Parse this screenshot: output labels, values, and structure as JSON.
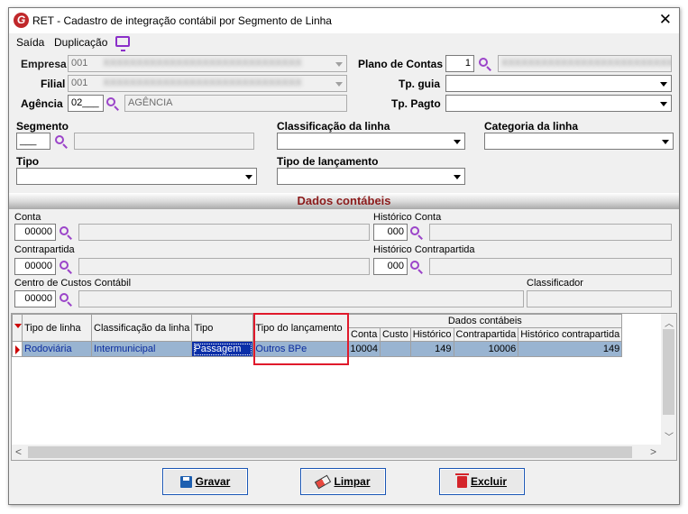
{
  "window": {
    "title": "RET - Cadastro de integração contábil por Segmento de Linha",
    "app_icon_letter": "G"
  },
  "menu": {
    "saida": "Saída",
    "duplicacao": "Duplicação"
  },
  "form": {
    "empresa": {
      "label": "Empresa",
      "code": "001",
      "desc": "XXXXXXXXXXXXXXXXXXXXXXXXXXXXXX"
    },
    "filial": {
      "label": "Filial",
      "code": "001",
      "desc": "XXXXXXXXXXXXXXXXXXXXXXXXXXXXXX"
    },
    "agencia": {
      "label": "Agência",
      "code": "02___",
      "desc": "AGÊNCIA"
    },
    "plano_contas": {
      "label": "Plano de Contas",
      "value": "1",
      "desc": "XXXXXXXXXXXXXXXXXXXXXXXXXXXX"
    },
    "tp_guia": {
      "label": "Tp. guia",
      "value": ""
    },
    "tp_pagto": {
      "label": "Tp. Pagto",
      "value": ""
    },
    "segmento": {
      "label": "Segmento",
      "value": "___",
      "desc": ""
    },
    "classificacao_linha": {
      "label": "Classificação da linha",
      "value": ""
    },
    "categoria_linha": {
      "label": "Categoria da linha",
      "value": ""
    },
    "tipo": {
      "label": "Tipo",
      "value": ""
    },
    "tipo_lancamento": {
      "label": "Tipo de lançamento",
      "value": ""
    }
  },
  "dados_contabeis": {
    "section_title": "Dados contábeis",
    "conta": {
      "label": "Conta",
      "value": "00000",
      "desc": ""
    },
    "historico_conta": {
      "label": "Histórico Conta",
      "value": "000",
      "desc": ""
    },
    "contrapartida": {
      "label": "Contrapartida",
      "value": "00000",
      "desc": ""
    },
    "historico_contrapartida": {
      "label": "Histórico Contrapartida",
      "value": "000",
      "desc": ""
    },
    "centro_custos": {
      "label": "Centro de Custos Contábil",
      "value": "00000",
      "desc": ""
    },
    "classificador": {
      "label": "Classificador",
      "value": ""
    }
  },
  "grid": {
    "group_header": "Dados contábeis",
    "columns": [
      "Tipo de linha",
      "Classificação da linha",
      "Tipo",
      "Tipo do lançamento",
      "Conta",
      "Custo",
      "Histórico",
      "Contrapartida",
      "Histórico contrapartida"
    ],
    "rows": [
      {
        "tipo_linha": "Rodoviária",
        "classificacao": "Intermunicipal",
        "tipo": "Passagem",
        "tipo_lancamento": "Outros BPe",
        "conta": "10004",
        "custo": "",
        "historico": "149",
        "contrapartida": "10006",
        "historico_contrapartida": "149"
      }
    ]
  },
  "buttons": {
    "gravar": "Gravar",
    "limpar": "Limpar",
    "excluir": "Excluir"
  },
  "colors": {
    "accent_red": "#c0282b",
    "icon_purple": "#9b44c9",
    "section_title": "#8b1a1a",
    "row_selected": "#99b4d1",
    "highlight_box": "#e0192b"
  },
  "icons": {
    "close": "close-icon",
    "search": "search-icon",
    "monitor": "monitor-icon",
    "save": "floppy-icon",
    "clear": "eraser-icon",
    "delete": "trash-icon"
  }
}
